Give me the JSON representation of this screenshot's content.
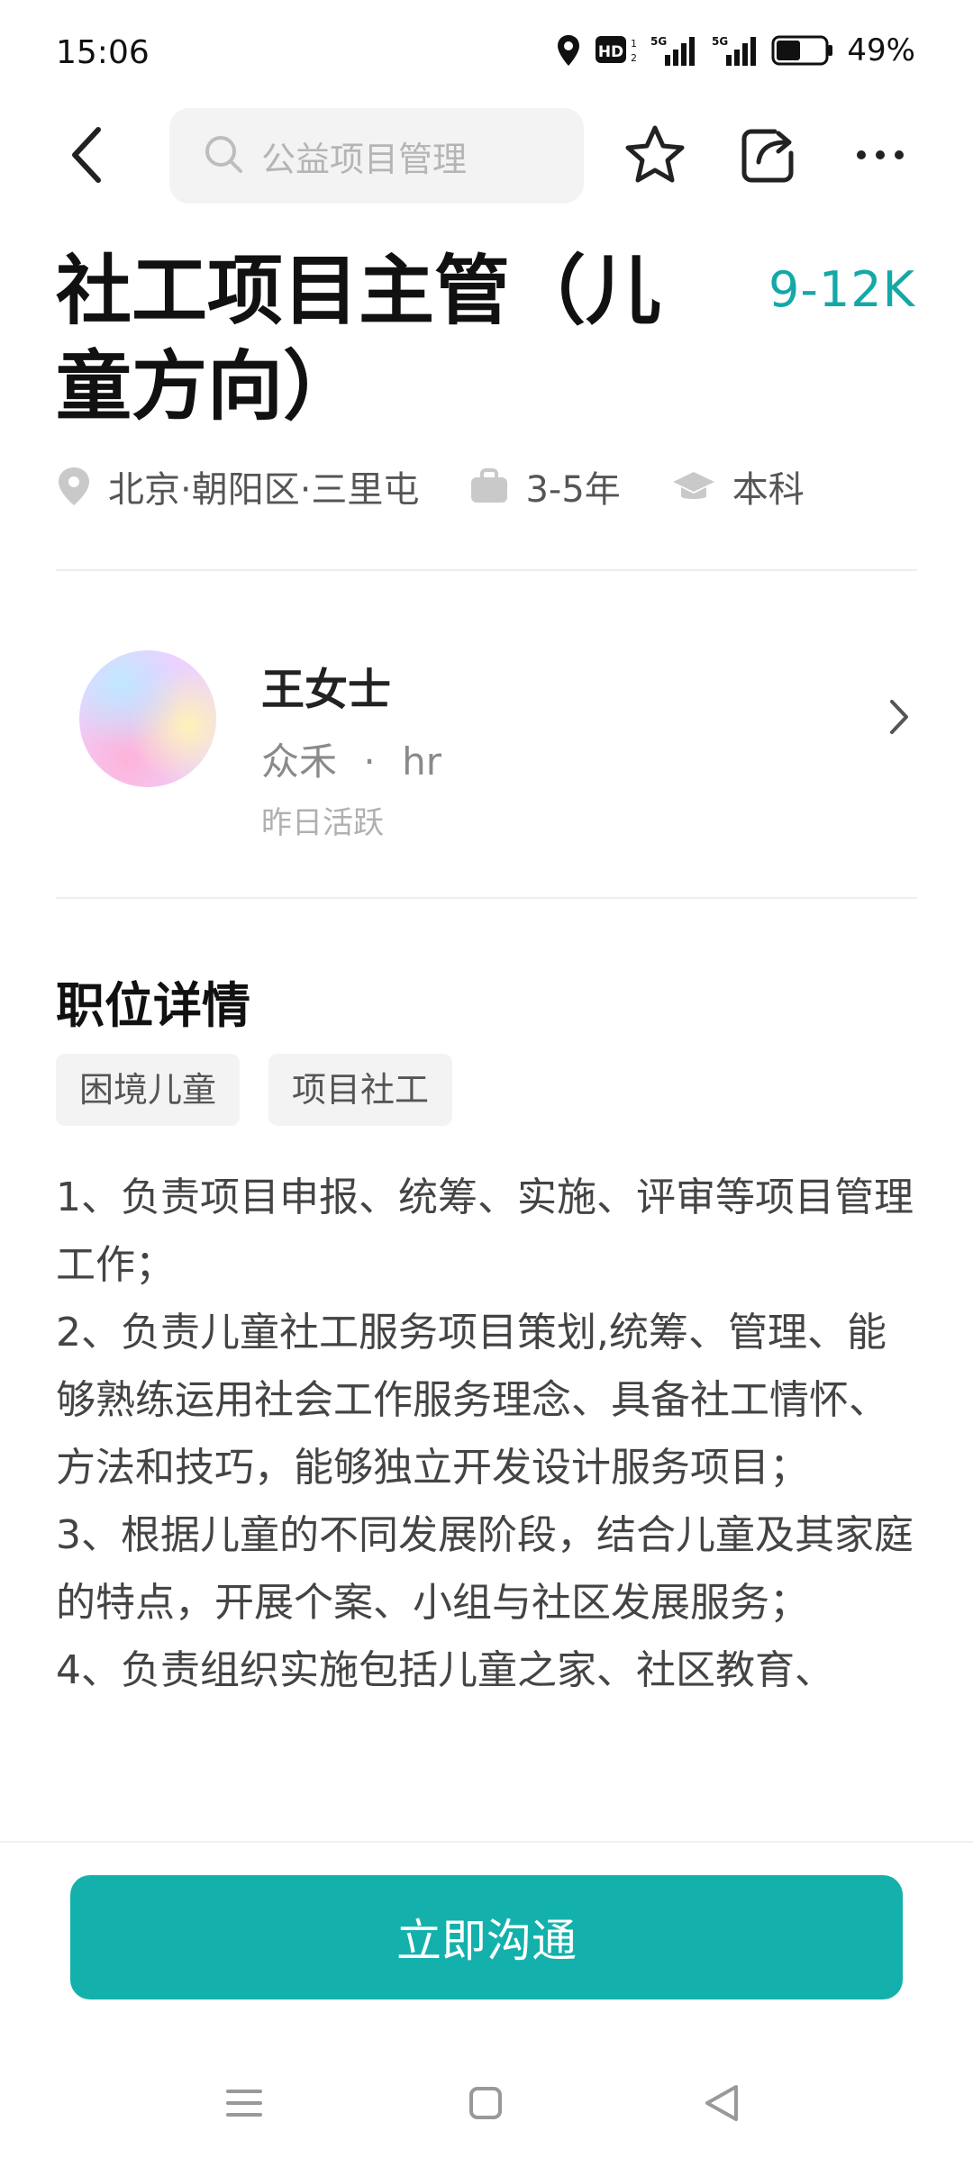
{
  "status_bar": {
    "time": "15:06",
    "battery": "49%",
    "icons": [
      "location-icon",
      "hd-icon",
      "signal-5g-icon",
      "signal-5g-icon",
      "battery-icon"
    ],
    "hd_label": "HD",
    "net_label_1": "5G",
    "net_label_2": "5G"
  },
  "top_bar": {
    "search_placeholder": "公益项目管理",
    "icons": [
      "back-icon",
      "search-icon",
      "star-icon",
      "share-icon",
      "more-icon"
    ]
  },
  "job": {
    "title_line1": "社工项目主管（儿",
    "title_line2": "童方向）",
    "salary": "9-12K",
    "location": "北京·朝阳区·三里屯",
    "experience": "3-5年",
    "education": "本科"
  },
  "recruiter": {
    "name": "王女士",
    "company": "众禾",
    "separator": "·",
    "role": "hr",
    "activity": "昨日活跃"
  },
  "details": {
    "section_title": "职位详情",
    "tags": [
      "困境儿童",
      "项目社工"
    ],
    "description_lines": [
      "1、负责项目申报、统筹、实施、评审等项目管理工作；",
      "2、负责儿童社工服务项目策划,统筹、管理、能够熟练运用社会工作服务理念、具备社工情怀、方法和技巧，能够独立开发设计服务项目；",
      "3、根据儿童的不同发展阶段，结合儿童及其家庭的特点，开展个案、小组与社区发展服务；",
      "4、负责组织实施包括儿童之家、社区教育、"
    ]
  },
  "cta": {
    "label": "立即沟通"
  },
  "colors": {
    "accent": "#14b1ac",
    "salary": "#14a8a7"
  },
  "nav_bar": {
    "icons": [
      "menu-icon",
      "home-icon",
      "back-triangle-icon"
    ]
  }
}
